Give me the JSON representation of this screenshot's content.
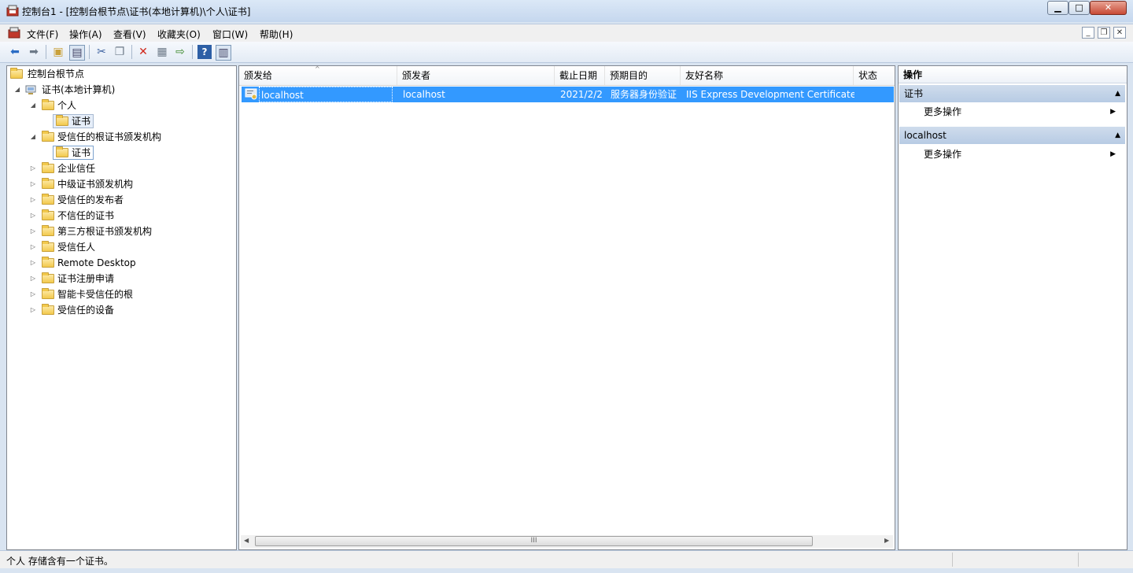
{
  "window": {
    "title": "控制台1 - [控制台根节点\\证书(本地计算机)\\个人\\证书]"
  },
  "menu": [
    "文件(F)",
    "操作(A)",
    "查看(V)",
    "收藏夹(O)",
    "窗口(W)",
    "帮助(H)"
  ],
  "toolbar_icons": [
    "back-arrow-icon",
    "forward-arrow-icon",
    "up-folder-icon",
    "show-hide-tree-icon",
    "cut-icon",
    "copy-icon",
    "delete-icon",
    "properties-icon",
    "export-icon",
    "help-icon",
    "action-pane-icon"
  ],
  "tree": {
    "root": "控制台根节点",
    "computer": "证书(本地计算机)",
    "personal": "个人",
    "personal_certs": "证书",
    "trusted_root": "受信任的根证书颁发机构",
    "trusted_root_certs": "证书",
    "others": [
      "企业信任",
      "中级证书颁发机构",
      "受信任的发布者",
      "不信任的证书",
      "第三方根证书颁发机构",
      "受信任人",
      "Remote Desktop",
      "证书注册申请",
      "智能卡受信任的根",
      "受信任的设备"
    ]
  },
  "list": {
    "columns": [
      "颁发给",
      "颁发者",
      "截止日期",
      "预期目的",
      "友好名称",
      "状态"
    ],
    "rows": [
      {
        "issued_to": "localhost",
        "issued_by": "localhost",
        "expiry": "2021/2/2",
        "purpose": "服务器身份验证",
        "friendly_name": "IIS Express Development Certificate",
        "status": ""
      }
    ],
    "scroll_grip": "III"
  },
  "actions": {
    "header": "操作",
    "sections": [
      {
        "title": "证书",
        "items": [
          "更多操作"
        ]
      },
      {
        "title": "localhost",
        "items": [
          "更多操作"
        ]
      }
    ]
  },
  "status": {
    "text": "个人 存储含有一个证书。"
  }
}
